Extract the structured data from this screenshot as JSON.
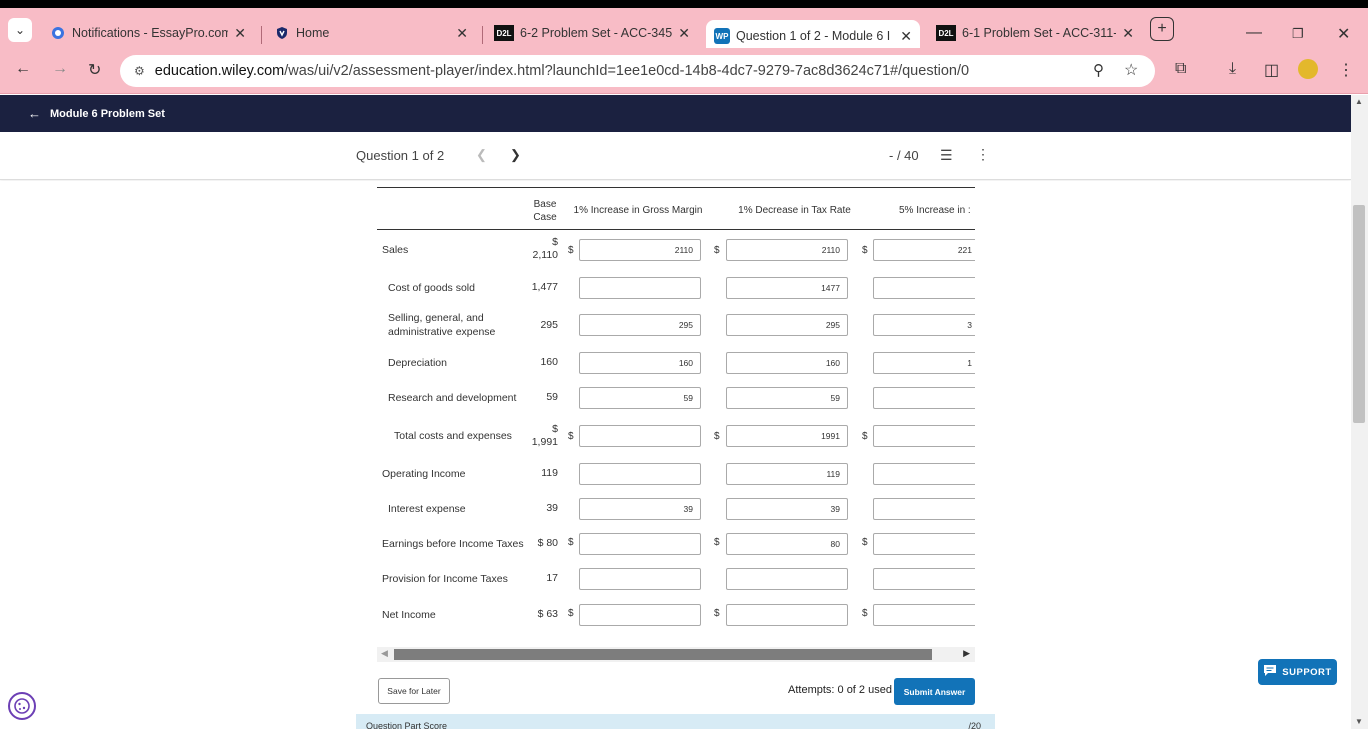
{
  "browser": {
    "tabs": [
      {
        "title": "Notifications - EssayPro.com",
        "icon": "essaypro-favicon"
      },
      {
        "title": "Home",
        "icon": "shield-favicon"
      },
      {
        "title": "6-2 Problem Set - ACC-345-",
        "icon": "d2l-favicon",
        "badge": "D2L"
      },
      {
        "title": "Question 1 of 2 - Module 6 I",
        "icon": "wileyplus-favicon",
        "badge": "WP"
      },
      {
        "title": "6-1 Problem Set - ACC-311-",
        "icon": "d2l-favicon",
        "badge": "D2L"
      }
    ],
    "url_host": "education.wiley.com",
    "url_path": "/was/ui/v2/assessment-player/index.html?launchId=1ee1e0cd-14b8-4dc7-9279-7ac8d3624c71#/question/0",
    "theme_color": "#f8bcc6"
  },
  "module_header": {
    "back_label": "Module 6 Problem Set"
  },
  "question_bar": {
    "title": "Question 1 of 2",
    "score": "- / 40"
  },
  "table": {
    "columns": {
      "base_l1": "Base",
      "base_l2": "Case",
      "c1": "1% Increase in Gross Margin",
      "c2": "1% Decrease in Tax Rate",
      "c3": "5% Increase in :"
    },
    "rows": [
      {
        "label": "Sales",
        "base": "$\n2,110",
        "c1": "2110",
        "c2": "2110",
        "c3": "221"
      },
      {
        "label": "Cost of goods sold",
        "base": "1,477",
        "c1": "",
        "c2": "1477",
        "c3": ""
      },
      {
        "label": "Selling, general, and\nadministrative expense",
        "base": "295",
        "c1": "295",
        "c2": "295",
        "c3": "3"
      },
      {
        "label": "Depreciation",
        "base": "160",
        "c1": "160",
        "c2": "160",
        "c3": "1"
      },
      {
        "label": "Research and development",
        "base": "59",
        "c1": "59",
        "c2": "59",
        "c3": ""
      },
      {
        "label": "Total costs and expenses",
        "base": "$\n1,991",
        "c1": "",
        "c2": "1991",
        "c3": ""
      },
      {
        "label": "Operating Income",
        "base": "119",
        "c1": "",
        "c2": "119",
        "c3": ""
      },
      {
        "label": "Interest expense",
        "base": "39",
        "c1": "39",
        "c2": "39",
        "c3": ""
      },
      {
        "label": "Earnings before Income Taxes",
        "base": "$ 80",
        "c1": "",
        "c2": "80",
        "c3": ""
      },
      {
        "label": "Provision for Income Taxes",
        "base": "17",
        "c1": "",
        "c2": "",
        "c3": ""
      },
      {
        "label": "Net Income",
        "base": "$ 63",
        "c1": "",
        "c2": "",
        "c3": ""
      }
    ],
    "currency_symbol": "$"
  },
  "footer": {
    "save_label": "Save for Later",
    "attempts": "Attempts: 0 of 2 used",
    "submit_label": "Submit Answer",
    "part_score_label": "Question Part Score",
    "part_score_value": "/20"
  },
  "support_label": "SUPPORT",
  "accent_color": "#1273b8",
  "header_color": "#1b2140"
}
